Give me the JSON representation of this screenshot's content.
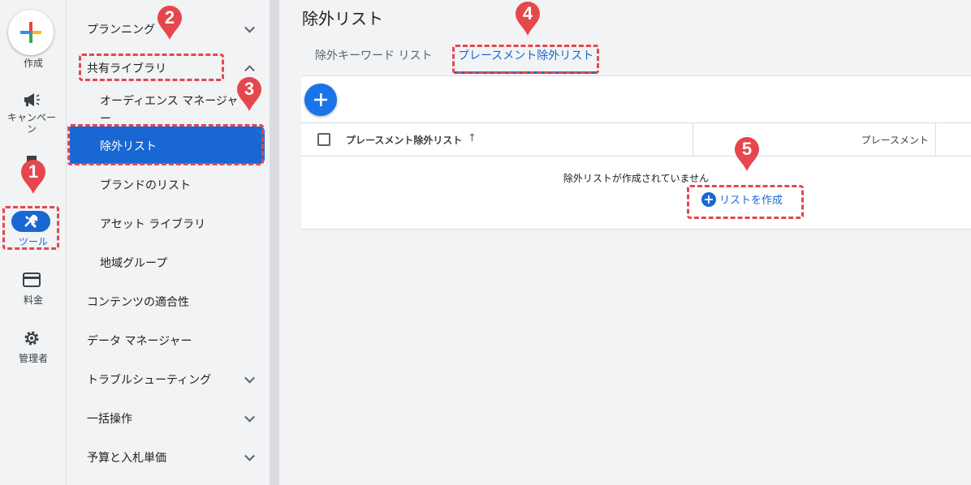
{
  "rail": {
    "create_label": "作成",
    "campaign_label": "キャンペーン",
    "tools_label": "ツール",
    "billing_label": "料金",
    "admin_label": "管理者"
  },
  "nav": {
    "items": [
      {
        "label": "プランニング",
        "expand": "down"
      },
      {
        "label": "共有ライブラリ",
        "expand": "up"
      },
      {
        "label": "オーディエンス マネージャー"
      },
      {
        "label": "除外リスト",
        "active": true
      },
      {
        "label": "ブランドのリスト"
      },
      {
        "label": "アセット ライブラリ"
      },
      {
        "label": "地域グループ"
      },
      {
        "label": "コンテンツの適合性"
      },
      {
        "label": "データ マネージャー"
      },
      {
        "label": "トラブルシューティング",
        "expand": "down"
      },
      {
        "label": "一括操作",
        "expand": "down"
      },
      {
        "label": "予算と入札単価",
        "expand": "down"
      }
    ]
  },
  "main": {
    "title": "除外リスト",
    "tabs": [
      {
        "label": "除外キーワード リスト"
      },
      {
        "label": "プレースメント除外リスト",
        "active": true
      }
    ],
    "table": {
      "col_name": "プレースメント除外リスト",
      "col_placement": "プレースメント"
    },
    "empty_text": "除外リストが作成されていません",
    "create_link": "リストを作成"
  },
  "annotations": [
    "1",
    "2",
    "3",
    "4",
    "5"
  ],
  "colors": {
    "accent": "#1967d2",
    "annotation": "#e5474c"
  }
}
